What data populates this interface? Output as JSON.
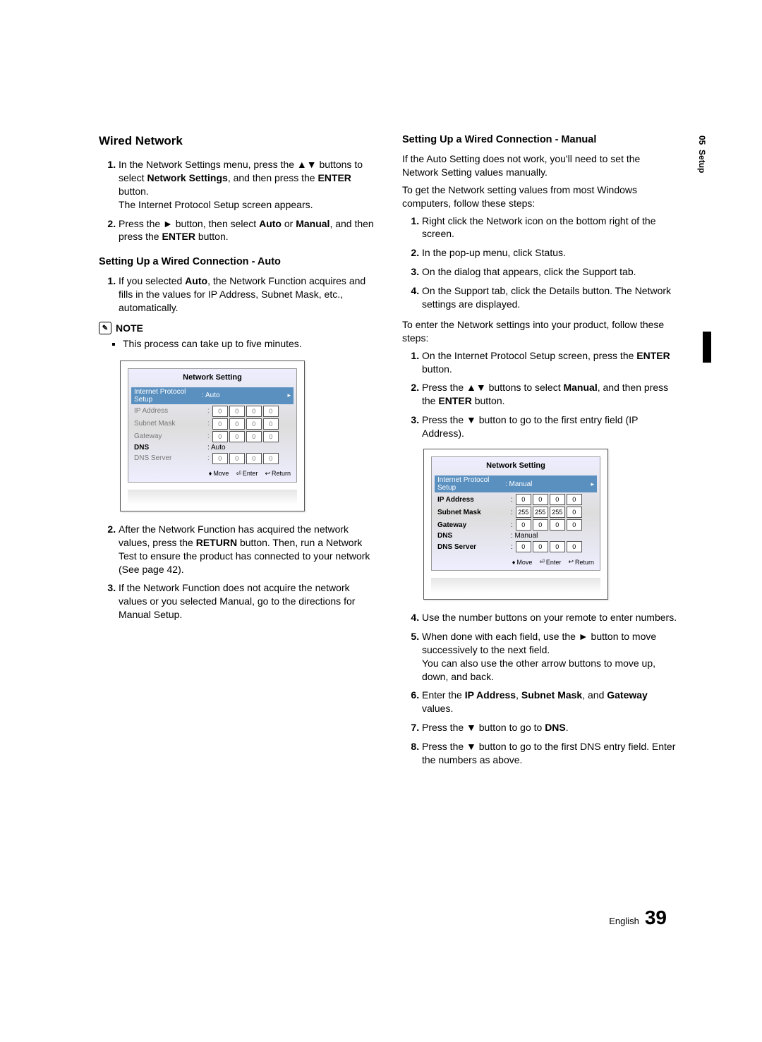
{
  "side": {
    "chapter_num": "05",
    "chapter_name": "Setup"
  },
  "footer": {
    "lang": "English",
    "page": "39"
  },
  "left": {
    "heading": "Wired Network",
    "steps_a": [
      "In the Network Settings menu, press the ▲▼ buttons to select Network Settings, and then press the ENTER button.\nThe Internet Protocol Setup screen appears.",
      "Press the ► button, then select Auto or Manual, and then press the ENTER button."
    ],
    "sub_auto": "Setting Up a Wired Connection - Auto",
    "steps_b": [
      "If you selected Auto, the Network Function acquires and fills in the values for IP Address, Subnet Mask, etc., automatically."
    ],
    "note_label": "NOTE",
    "note_items": [
      "This process can take up to five minutes."
    ],
    "steps_c": [
      "After the Network Function has acquired the network values, press the RETURN button. Then, run a Network Test to ensure the product has connected to your network (See page 42).",
      "If the Network Function does not acquire the network values or you selected Manual, go to the directions for Manual Setup."
    ]
  },
  "right": {
    "sub_manual": "Setting Up a Wired Connection - Manual",
    "intro1": "If the Auto Setting does not work, you'll need to set the Network Setting values manually.",
    "intro2": "To get the Network setting values from most Windows computers, follow these steps:",
    "steps_d": [
      "Right click the Network icon on the bottom right of the screen.",
      "In the pop-up menu, click Status.",
      "On the dialog that appears, click the Support tab.",
      "On the Support tab, click the Details button. The Network settings are displayed."
    ],
    "intro3": "To enter the Network settings into your product, follow these steps:",
    "steps_e": [
      "On the Internet Protocol Setup screen, press the ENTER button.",
      "Press the ▲▼ buttons to select Manual, and then press the ENTER button.",
      "Press the ▼ button to go to the first entry field (IP Address)."
    ],
    "steps_f": [
      "Use the number buttons on your remote to enter numbers.",
      "When done with each field, use the ► button to move successively to the next field.\nYou can also use the other arrow buttons to move up, down, and back.",
      "Enter the IP Address, Subnet Mask, and Gateway values.",
      "Press the ▼ button to go to DNS.",
      "Press the ▼ button to go to the first DNS entry field. Enter the numbers as above."
    ]
  },
  "screen_auto": {
    "title": "Network Setting",
    "proto_label": "Internet Protocol Setup",
    "proto_val": ": Auto",
    "rows": [
      {
        "label": "IP Address",
        "v": [
          "0",
          "0",
          "0",
          "0"
        ],
        "dim": true
      },
      {
        "label": "Subnet Mask",
        "v": [
          "0",
          "0",
          "0",
          "0"
        ],
        "dim": true
      },
      {
        "label": "Gateway",
        "v": [
          "0",
          "0",
          "0",
          "0"
        ],
        "dim": true
      }
    ],
    "dns_label": "DNS",
    "dns_val": ": Auto",
    "dns_server": {
      "label": "DNS Server",
      "v": [
        "0",
        "0",
        "0",
        "0"
      ],
      "dim": true
    },
    "hints": {
      "move": "Move",
      "enter": "Enter",
      "return": "Return"
    }
  },
  "screen_manual": {
    "title": "Network Setting",
    "proto_label": "Internet Protocol Setup",
    "proto_val": ": Manual",
    "rows": [
      {
        "label": "IP Address",
        "v": [
          "0",
          "0",
          "0",
          "0"
        ]
      },
      {
        "label": "Subnet Mask",
        "v": [
          "255",
          "255",
          "255",
          "0"
        ]
      },
      {
        "label": "Gateway",
        "v": [
          "0",
          "0",
          "0",
          "0"
        ]
      }
    ],
    "dns_label": "DNS",
    "dns_val": ": Manual",
    "dns_server": {
      "label": "DNS Server",
      "v": [
        "0",
        "0",
        "0",
        "0"
      ]
    },
    "hints": {
      "move": "Move",
      "enter": "Enter",
      "return": "Return"
    }
  }
}
